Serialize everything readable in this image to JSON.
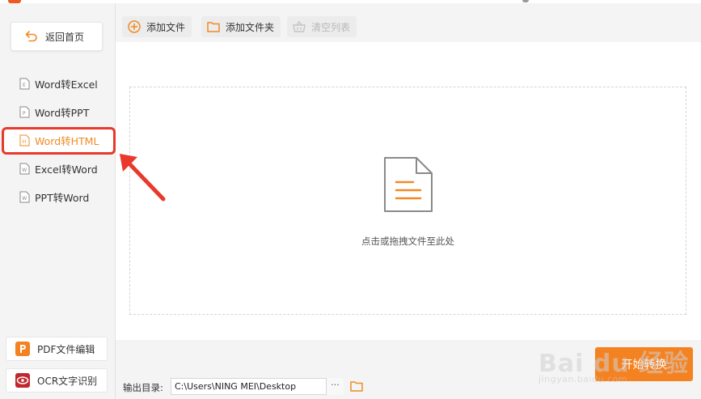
{
  "sidebar": {
    "back_label": "返回首页",
    "items": [
      {
        "label": "Word转Excel",
        "active": false
      },
      {
        "label": "Word转PPT",
        "active": false
      },
      {
        "label": "Word转HTML",
        "active": true
      },
      {
        "label": "Excel转Word",
        "active": false
      },
      {
        "label": "PPT转Word",
        "active": false
      }
    ],
    "pdf_editor_label": "PDF文件编辑",
    "ocr_label": "OCR文字识别"
  },
  "toolbar": {
    "add_file_label": "添加文件",
    "add_folder_label": "添加文件夹",
    "clear_list_label": "清空列表"
  },
  "dropzone": {
    "hint": "点击或拖拽文件至此处"
  },
  "output": {
    "label": "输出目录:",
    "path": "C:\\Users\\NING MEI\\Desktop",
    "browse_label": "···"
  },
  "start_label": "开始转换",
  "watermark": {
    "main": "Bai du 经验",
    "sub": "jingyan.baidu.com"
  },
  "colors": {
    "accent": "#f58220",
    "highlight": "#e8392c",
    "active_text": "#f08a24"
  },
  "icons": {
    "back": "undo-arrow-icon",
    "nav_doc": "document-icon",
    "add_file": "plus-circle-icon",
    "add_folder": "folder-icon",
    "clear_list": "basket-icon",
    "drop": "file-lines-icon",
    "pdf": "pdf-logo-icon",
    "ocr": "eye-icon"
  }
}
